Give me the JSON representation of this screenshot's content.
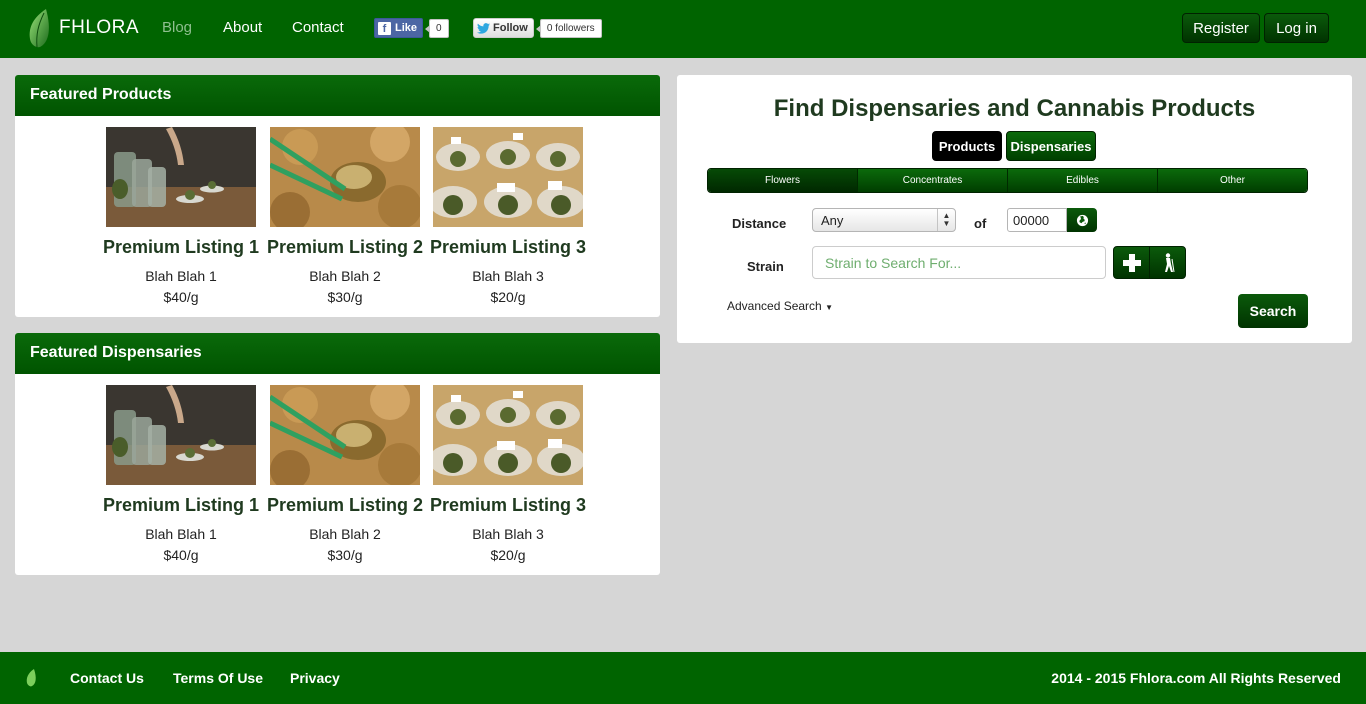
{
  "nav": {
    "brand": "FHLORA",
    "links": [
      "Blog",
      "About",
      "Contact"
    ],
    "fb_like_label": "Like",
    "fb_like_count": "0",
    "tw_follow_label": "Follow",
    "tw_followers": "0 followers",
    "register_label": "Register",
    "login_label": "Log in"
  },
  "featured_products": {
    "title": "Featured Products",
    "items": [
      {
        "title": "Premium Listing 1",
        "desc": "Blah Blah 1",
        "price": "$40/g"
      },
      {
        "title": "Premium Listing 2",
        "desc": "Blah Blah 2",
        "price": "$30/g"
      },
      {
        "title": "Premium Listing 3",
        "desc": "Blah Blah 3",
        "price": "$20/g"
      }
    ]
  },
  "featured_dispensaries": {
    "title": "Featured Dispensaries",
    "items": [
      {
        "title": "Premium Listing 1",
        "desc": "Blah Blah 1",
        "price": "$40/g"
      },
      {
        "title": "Premium Listing 2",
        "desc": "Blah Blah 2",
        "price": "$30/g"
      },
      {
        "title": "Premium Listing 3",
        "desc": "Blah Blah 3",
        "price": "$20/g"
      }
    ]
  },
  "search": {
    "title": "Find Dispensaries and Cannabis Products",
    "mode_products": "Products",
    "mode_dispensaries": "Dispensaries",
    "categories": [
      "Flowers",
      "Concentrates",
      "Edibles",
      "Other"
    ],
    "distance_label": "Distance",
    "distance_value": "Any",
    "of_label": "of",
    "zip_value": "00000",
    "strain_label": "Strain",
    "strain_placeholder": "Strain to Search For...",
    "advanced_label": "Advanced Search",
    "search_button": "Search"
  },
  "footer": {
    "links": [
      "Contact Us",
      "Terms Of Use",
      "Privacy"
    ],
    "copyright": "2014 - 2015 Fhlora.com All Rights Reserved"
  },
  "colors": {
    "brand_green": "#006400",
    "dark_green": "#003300",
    "page_bg": "#d6d6d6"
  }
}
